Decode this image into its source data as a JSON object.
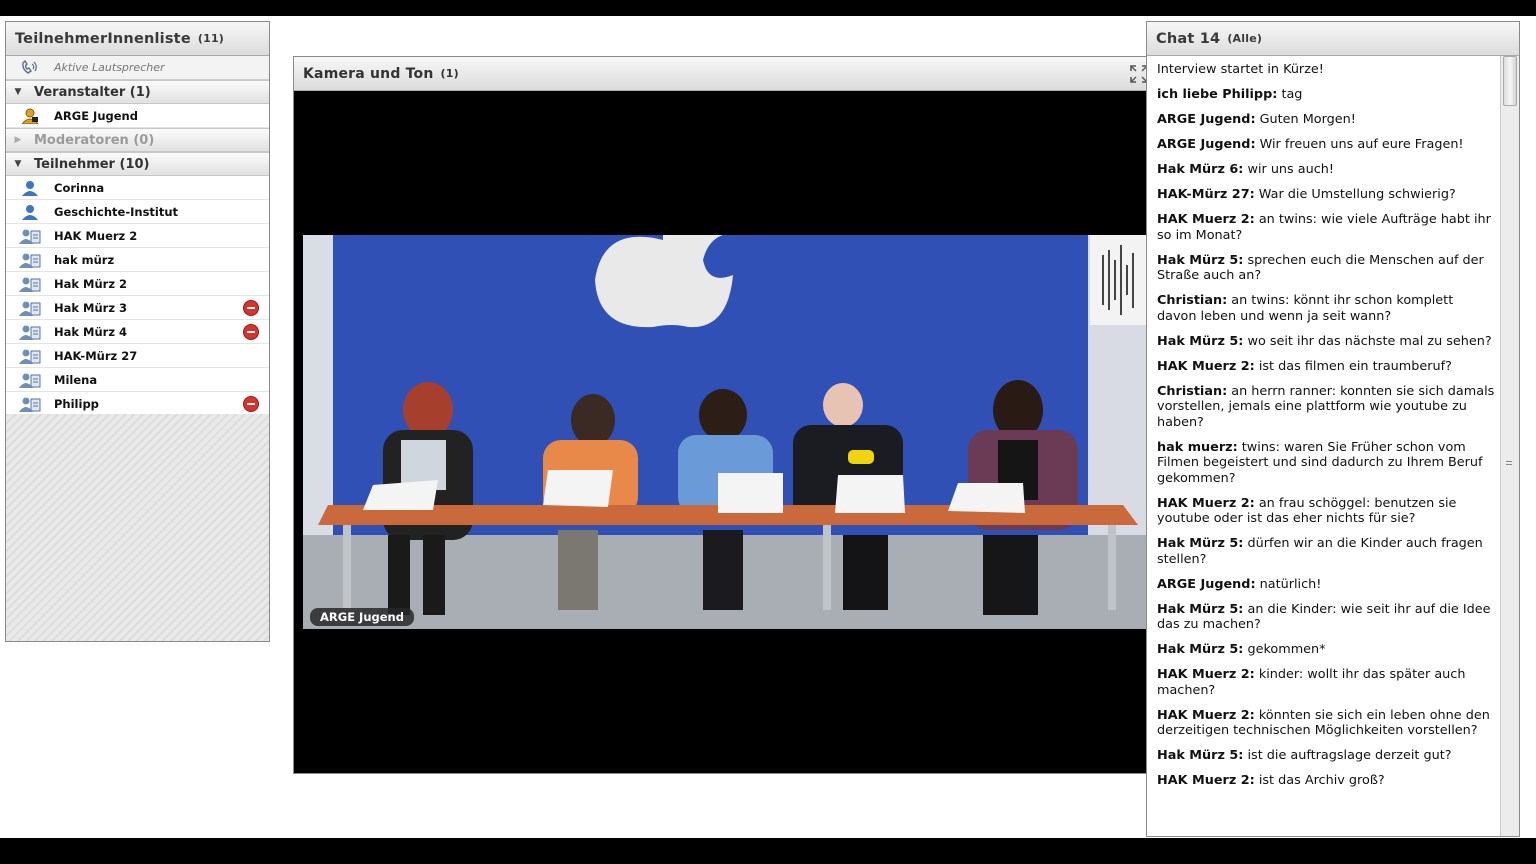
{
  "participants": {
    "title": "TeilnehmerInnenliste",
    "count": "(11)",
    "active_speakers": "Aktive Lautsprecher",
    "groups": {
      "hosts": "Veranstalter (1)",
      "moderators": "Moderatoren (0)",
      "members": "Teilnehmer (10)"
    },
    "hosts": [
      "ARGE Jugend"
    ],
    "members": [
      "Corinna",
      "Geschichte-Institut",
      "HAK Muerz 2",
      "hak mürz",
      "Hak Mürz 2",
      "Hak Mürz 3",
      "Hak Mürz 4",
      "HAK-Mürz 27",
      "Milena",
      "Philipp"
    ]
  },
  "camera": {
    "title": "Kamera und Ton",
    "count": "(1)",
    "video_label": "ARGE Jugend"
  },
  "chat": {
    "title": "Chat 14",
    "scope": "(Alle)",
    "messages": [
      {
        "author": "",
        "text": "Interview startet in Kürze!"
      },
      {
        "author": "ich liebe Philipp:",
        "text": " tag"
      },
      {
        "author": "ARGE Jugend:",
        "text": " Guten Morgen!"
      },
      {
        "author": "ARGE Jugend:",
        "text": " Wir freuen uns auf eure Fragen!"
      },
      {
        "author": "Hak Mürz 6:",
        "text": " wir uns auch!"
      },
      {
        "author": "HAK-Mürz 27:",
        "text": " War die Umstellung schwierig?"
      },
      {
        "author": "HAK Muerz 2:",
        "text": " an twins: wie viele Aufträge habt ihr so im Monat?"
      },
      {
        "author": "Hak Mürz 5:",
        "text": " sprechen euch die Menschen auf der Straße auch an?"
      },
      {
        "author": "Christian:",
        "text": " an twins: könnt ihr schon komplett davon leben und wenn ja seit wann?"
      },
      {
        "author": "Hak Mürz 5:",
        "text": " wo seit ihr das nächste mal zu sehen?"
      },
      {
        "author": "HAK Muerz 2:",
        "text": " ist das filmen ein traumberuf?"
      },
      {
        "author": "Christian:",
        "text": " an herrn ranner: konnten sie sich damals vorstellen, jemals eine plattform wie youtube zu haben?"
      },
      {
        "author": "hak muerz:",
        "text": " twins: waren Sie Früher schon vom Filmen begeistert und sind dadurch zu Ihrem Beruf gekommen?"
      },
      {
        "author": "HAK Muerz 2:",
        "text": " an frau schöggel: benutzen sie youtube oder ist das eher nichts für sie?"
      },
      {
        "author": "Hak Mürz 5:",
        "text": " dürfen wir an die Kinder auch fragen stellen?"
      },
      {
        "author": "ARGE Jugend:",
        "text": " natürlich!"
      },
      {
        "author": "Hak Mürz 5:",
        "text": " an die Kinder: wie seit ihr auf die Idee das zu machen?"
      },
      {
        "author": "Hak Mürz 5:",
        "text": " gekommen*"
      },
      {
        "author": "HAK Muerz 2:",
        "text": " kinder: wollt ihr das später auch machen?"
      },
      {
        "author": "HAK Muerz 2:",
        "text": " könnten sie sich ein leben ohne den derzeitigen technischen Möglichkeiten vorstellen?"
      },
      {
        "author": "Hak Mürz 5:",
        "text": " ist die auftragslage derzeit gut?"
      },
      {
        "author": "HAK Muerz 2:",
        "text": " ist das Archiv groß?"
      }
    ]
  },
  "colors": {
    "remove": "#d8322b",
    "video_bg": "#2f4db3",
    "host_icon": "#e0a21a",
    "user_icon": "#3d74c4"
  }
}
